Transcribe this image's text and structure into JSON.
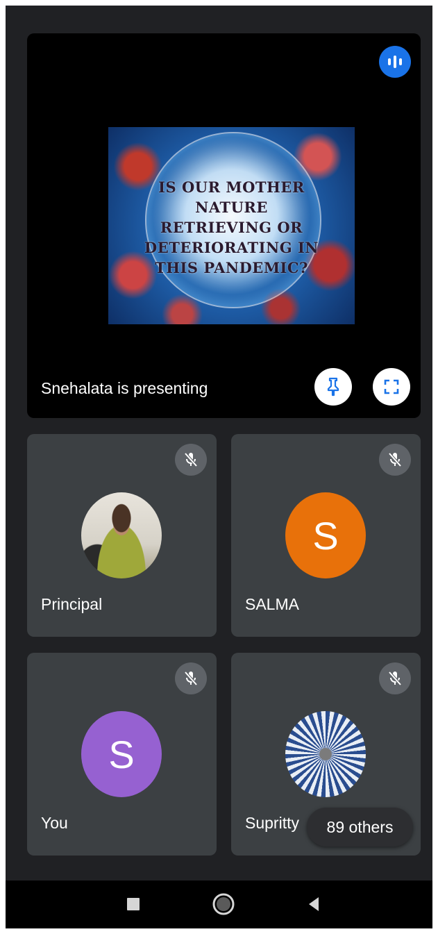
{
  "presentation": {
    "slide_text": "IS OUR MOTHER\nNATURE\nRETRIEVING OR\nDETERIORATING IN\nTHIS PANDEMIC?",
    "presenter_label": "Snehalata is presenting",
    "icons": {
      "audio": "audio-level-icon",
      "pin": "pin-icon",
      "fullscreen": "fullscreen-icon"
    }
  },
  "participants": [
    {
      "name": "Principal",
      "avatar_type": "photo",
      "muted": true
    },
    {
      "name": "SALMA",
      "avatar_letter": "S",
      "avatar_color": "#e8710a",
      "muted": true
    },
    {
      "name": "You",
      "avatar_letter": "S",
      "avatar_color": "#9661d1",
      "muted": true
    },
    {
      "name": "Supritty",
      "avatar_type": "photo",
      "muted": true
    }
  ],
  "others_chip": "89 others",
  "colors": {
    "background": "#202124",
    "tile": "#3c4043",
    "accent": "#1a73e8"
  },
  "navbar": {
    "icons": [
      "recent-apps-icon",
      "home-icon",
      "back-icon"
    ]
  }
}
